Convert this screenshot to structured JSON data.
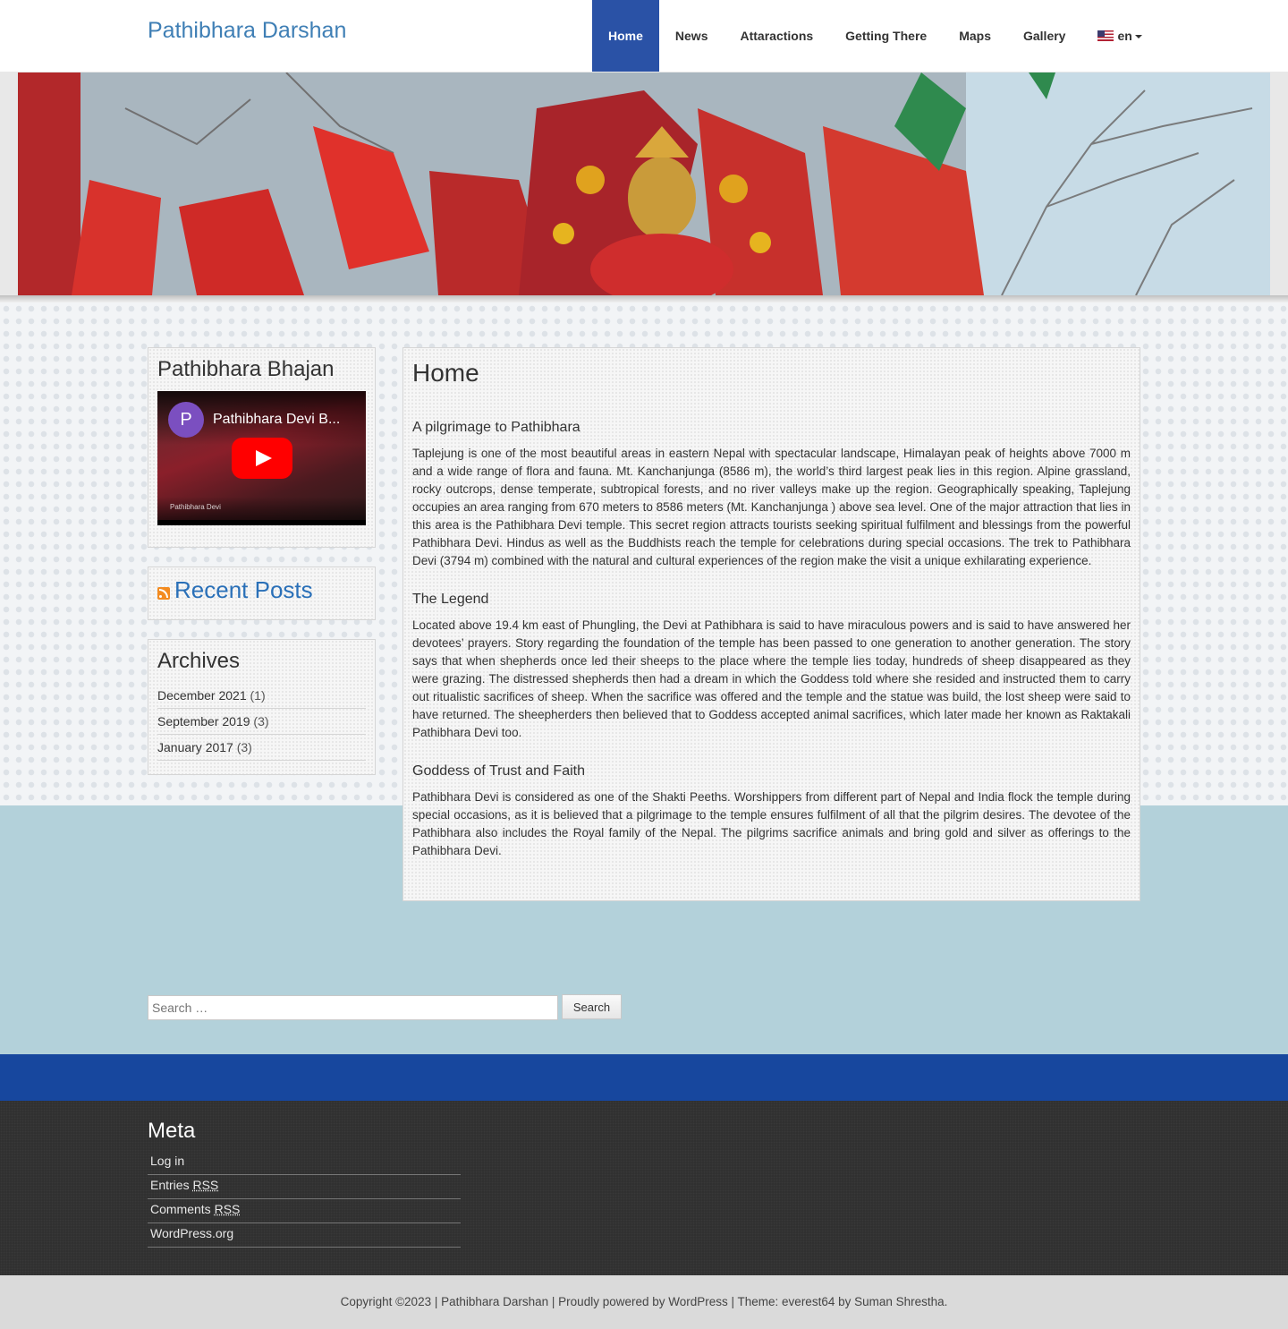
{
  "site": {
    "title": "Pathibhara Darshan"
  },
  "nav": {
    "items": [
      {
        "label": "Home"
      },
      {
        "label": "News"
      },
      {
        "label": "Attaractions"
      },
      {
        "label": "Getting There"
      },
      {
        "label": "Maps"
      },
      {
        "label": "Gallery"
      }
    ],
    "language": "en"
  },
  "sidebar": {
    "bhajan": {
      "title": "Pathibhara Bhajan",
      "video_title": "Pathibhara Devi B...",
      "video_avatar": "P",
      "video_caption": "Pathibhara Devi"
    },
    "recent_posts": {
      "title": "Recent Posts"
    },
    "archives": {
      "title": "Archives",
      "items": [
        {
          "label": "December 2021",
          "count": "(1)"
        },
        {
          "label": "September 2019",
          "count": "(3)"
        },
        {
          "label": "January 2017",
          "count": "(3)"
        }
      ]
    }
  },
  "main": {
    "title": "Home",
    "sections": [
      {
        "heading": "A pilgrimage to Pathibhara",
        "text": "Taplejung is one of the most beautiful areas in eastern Nepal with spectacular landscape, Himalayan peak of heights above 7000 m and a wide range of flora and fauna. Mt. Kanchanjunga (8586 m), the world’s third largest peak lies in this region. Alpine grassland, rocky outcrops, dense temperate, subtropical forests, and no river valleys make up the region. Geographically speaking, Taplejung occupies an area ranging from 670 meters to 8586 meters (Mt. Kanchanjunga ) above sea level. One of the major attraction that lies in this area is the Pathibhara Devi temple. This secret region attracts tourists seeking spiritual fulfilment and blessings from the powerful Pathibhara Devi. Hindus as well as the Buddhists reach the temple for celebrations during special occasions. The trek to Pathibhara Devi (3794 m) combined with the natural and cultural experiences of the region make the visit a unique exhilarating experience."
      },
      {
        "heading": "The Legend",
        "text": "Located above 19.4 km east of Phungling, the Devi at Pathibhara is said to have miraculous powers and is said to have answered her devotees’ prayers. Story regarding the foundation of the temple has been passed to one generation to another generation. The story says that when shepherds once led their sheeps to the place where the temple lies today, hundreds of sheep disappeared as they were grazing. The distressed shepherds then had a dream in which the Goddess told where she resided and instructed them to carry out ritualistic sacrifices of sheep. When the sacrifice was offered and the temple and the statue was build, the lost sheep were said to have returned. The sheepherders then believed that to Goddess accepted animal sacrifices, which later made her known as Raktakali Pathibhara Devi too."
      },
      {
        "heading": "Goddess of Trust and Faith",
        "text": "Pathibhara Devi is considered as one of the Shakti Peeths. Worshippers from different part of Nepal and India flock the temple during special occasions, as it is believed that a pilgrimage to the temple ensures fulfilment of all that the pilgrim desires. The devotee of the Pathibhara also includes the Royal family of the Nepal. The pilgrims sacrifice animals and bring gold and silver as offerings to the Pathibhara Devi."
      }
    ]
  },
  "search": {
    "placeholder": "Search …",
    "button_label": "Search"
  },
  "footer": {
    "meta_title": "Meta",
    "links": {
      "login": "Log in",
      "entries": "Entries",
      "comments": "Comments",
      "rss": "RSS",
      "wordpress": "WordPress.org"
    },
    "copyright": "Copyright ©2023 | Pathibhara Darshan | Proudly powered by WordPress | Theme: everest64 by Suman Shrestha."
  },
  "colors": {
    "brand": "#3f7fb5",
    "nav_active": "#2a52a6",
    "blue_band": "#17479e",
    "light_blue_bg": "#b3d1da",
    "footer_dark": "#2e2e2e"
  },
  "icons": [
    "us-flag-icon",
    "caret-down-icon",
    "rss-icon",
    "youtube-play-icon"
  ]
}
